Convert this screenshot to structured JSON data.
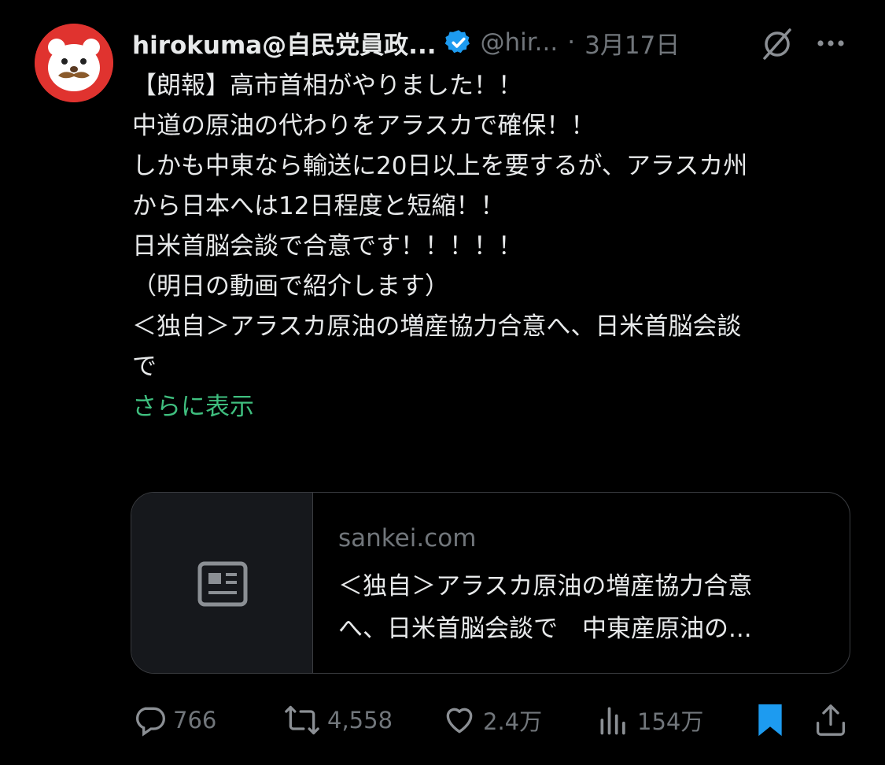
{
  "post": {
    "author_name": "hirokuma@自民党員政...",
    "handle": "@hir...",
    "separator": "·",
    "date": "3月17日",
    "body_lines": [
      "【朗報】高市首相がやりました！！",
      "中道の原油の代わりをアラスカで確保！！",
      "しかも中東なら輸送に20日以上を要するが、アラスカ州",
      "から日本へは12日程度と短縮！！",
      "日米首脳会談で合意です！！！！！",
      "（明日の動画で紹介します）",
      "",
      "＜独自＞アラスカ原油の増産協力合意へ、日米首脳会談",
      "で"
    ],
    "show_more": "さらに表示"
  },
  "link_card": {
    "domain": "sankei.com",
    "title_line1": "＜独自＞アラスカ原油の増産協力合意",
    "title_line2": "へ、日米首脳会談で　中東産原油の..."
  },
  "actions": {
    "replies": "766",
    "reposts": "4,558",
    "likes": "2.4万",
    "views": "154万"
  },
  "icons": [
    "avatar-bear",
    "verified-badge-icon",
    "grok-icon",
    "more-icon",
    "news-icon",
    "reply-icon",
    "repost-icon",
    "like-icon",
    "views-icon",
    "bookmark-icon",
    "share-icon"
  ],
  "colors": {
    "background": "#000000",
    "text": "#e7e9ea",
    "muted": "#71767b",
    "verified": "#1d9bf0",
    "bookmark": "#1d9bf0",
    "show_more": "#3fbf7f",
    "avatar_bg": "#e0332f"
  }
}
